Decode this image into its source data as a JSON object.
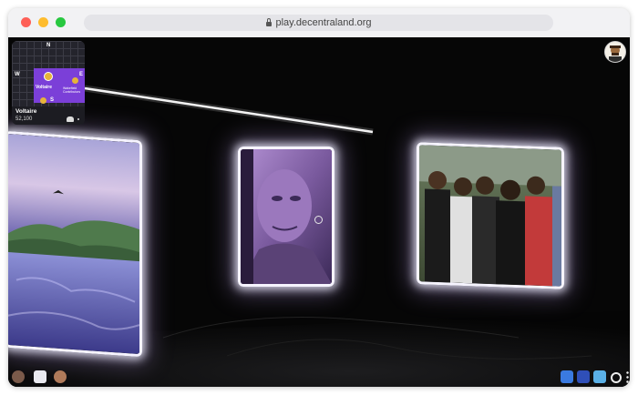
{
  "browser": {
    "url": "play.decentraland.org",
    "traffic_lights": [
      "close",
      "minimize",
      "maximize"
    ]
  },
  "minimap": {
    "compass": {
      "north": "N",
      "west": "W",
      "south": "S",
      "east": "E"
    },
    "scene_label": "Voltaire",
    "scene_sub_label": "Wakefield Contributors",
    "location_name": "Voltaire",
    "coordinates": "52,100",
    "accent_color": "#7b3fd8"
  },
  "scene": {
    "frames": [
      "landscape-painting",
      "old-man-portrait",
      "group-photo"
    ],
    "glow_color": "#ffffff"
  },
  "bottom_bar": {
    "left_icons": [
      "profile-icon",
      "chat-icon",
      "friends-icon"
    ],
    "right_icons": [
      "builder-icon",
      "flag-icon",
      "explore-icon",
      "settings-icon",
      "more-icon"
    ]
  }
}
